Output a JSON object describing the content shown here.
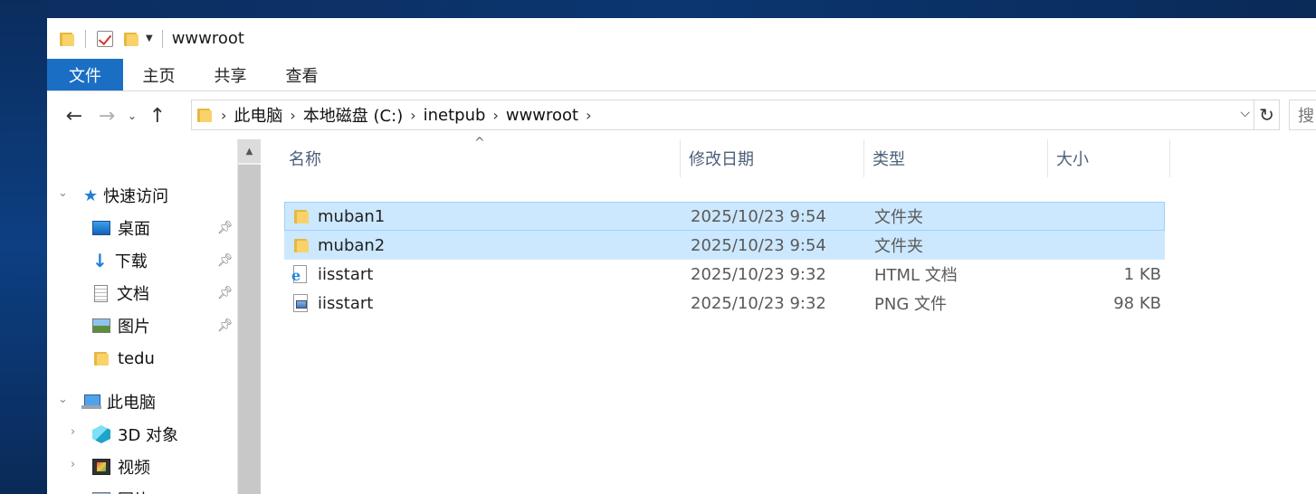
{
  "window": {
    "title": "wwwroot"
  },
  "ribbon": {
    "tabs": [
      "文件",
      "主页",
      "共享",
      "查看"
    ]
  },
  "address": {
    "crumbs": [
      "此电脑",
      "本地磁盘 (C:)",
      "inetpub",
      "wwwroot"
    ],
    "search_placeholder": "搜"
  },
  "nav": {
    "quick_access": "快速访问",
    "items": [
      {
        "label": "桌面",
        "icon": "desktop-icon",
        "pinned": true
      },
      {
        "label": "下载",
        "icon": "download-icon",
        "pinned": true
      },
      {
        "label": "文档",
        "icon": "document-icon",
        "pinned": true
      },
      {
        "label": "图片",
        "icon": "picture-icon",
        "pinned": true
      },
      {
        "label": "tedu",
        "icon": "folder-icon",
        "pinned": false
      }
    ],
    "this_pc": "此电脑",
    "pc_items": [
      {
        "label": "3D 对象",
        "icon": "3d-objects-icon"
      },
      {
        "label": "视频",
        "icon": "video-icon"
      },
      {
        "label": "图片",
        "icon": "picture-icon"
      }
    ]
  },
  "columns": {
    "name": "名称",
    "modified": "修改日期",
    "type": "类型",
    "size": "大小"
  },
  "files": [
    {
      "name": "muban1",
      "modified": "2025/10/23 9:54",
      "type": "文件夹",
      "size": "",
      "icon": "folder-icon",
      "selected": true
    },
    {
      "name": "muban2",
      "modified": "2025/10/23 9:54",
      "type": "文件夹",
      "size": "",
      "icon": "folder-icon",
      "selected": true
    },
    {
      "name": "iisstart",
      "modified": "2025/10/23 9:32",
      "type": "HTML 文档",
      "size": "1 KB",
      "icon": "html-file-icon",
      "selected": false
    },
    {
      "name": "iisstart",
      "modified": "2025/10/23 9:32",
      "type": "PNG 文件",
      "size": "98 KB",
      "icon": "png-file-icon",
      "selected": false
    }
  ],
  "colors": {
    "accent": "#1a6fc4",
    "selection": "#cce8ff",
    "selection_border": "#99d1ff"
  }
}
